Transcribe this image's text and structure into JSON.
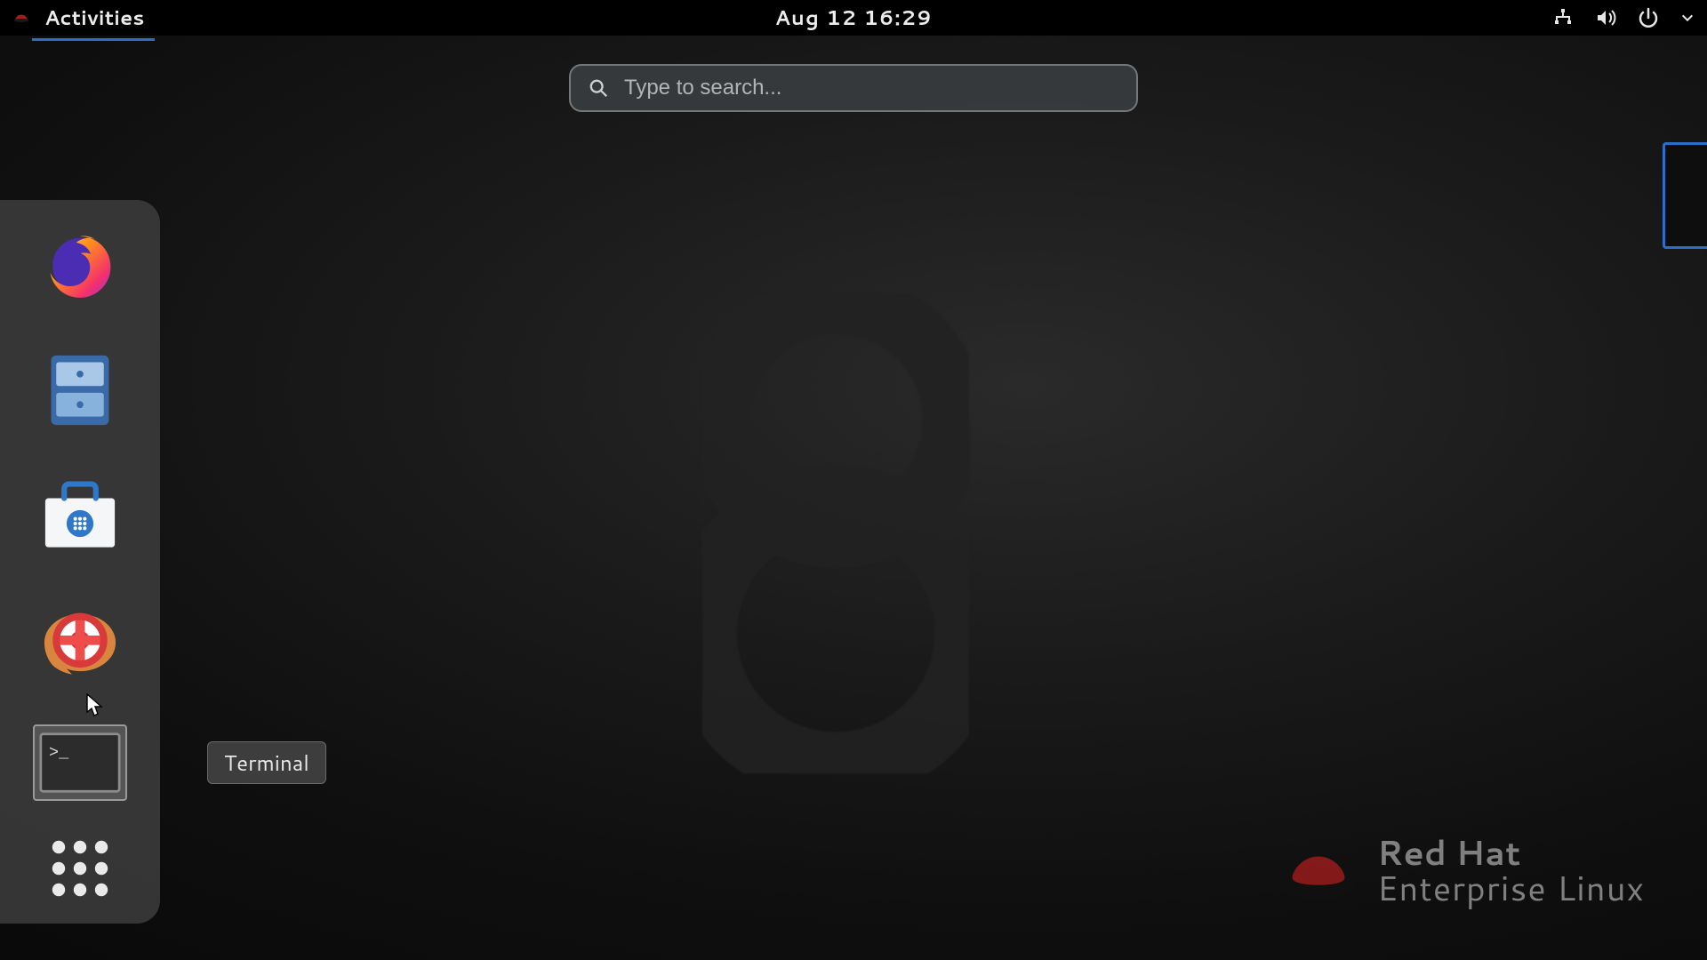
{
  "topbar": {
    "activities_label": "Activities",
    "datetime": "Aug 12  16:29"
  },
  "search": {
    "placeholder": "Type to search...",
    "value": ""
  },
  "dash": {
    "items": [
      {
        "name": "firefox",
        "label": "Firefox"
      },
      {
        "name": "files",
        "label": "Files"
      },
      {
        "name": "software",
        "label": "Software"
      },
      {
        "name": "help",
        "label": "Help"
      },
      {
        "name": "terminal",
        "label": "Terminal"
      },
      {
        "name": "apps",
        "label": "Show Applications"
      }
    ],
    "hovered_index": 4,
    "tooltip": "Terminal"
  },
  "branding": {
    "line1": "Red Hat",
    "line2": "Enterprise Linux"
  },
  "colors": {
    "accent": "#2a6fc9",
    "panel": "#3a3a3a"
  }
}
